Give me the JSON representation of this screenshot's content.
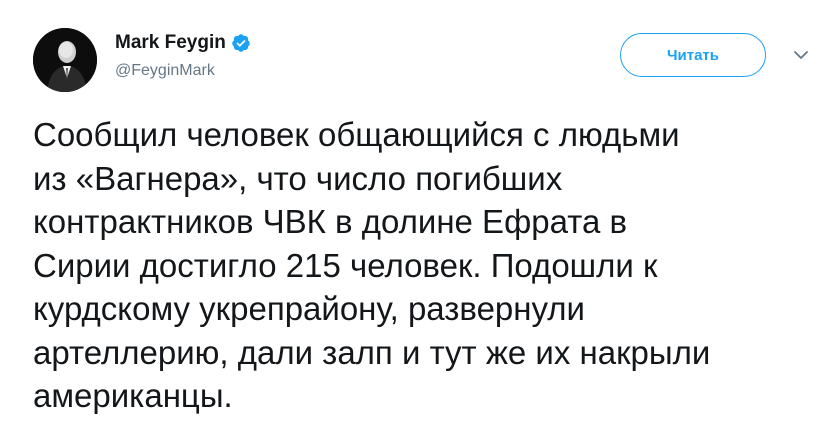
{
  "author": {
    "name": "Mark Feygin",
    "handle": "@FeyginMark",
    "verified": true
  },
  "follow_button": {
    "label": "Читать"
  },
  "icons": {
    "verified": "verified-badge-icon",
    "caret": "chevron-down-icon"
  },
  "tweet": {
    "lines": [
      "Сообщил человек общающийся с людьми",
      "из «Вагнера», что число погибших",
      "контрактников ЧВК в долине Ефрата в",
      "Сирии достигло 215 человек. Подошли к",
      "курдскому укрепрайону, развернули",
      "артеллерию, дали залп и тут же их накрыли",
      "американцы."
    ]
  },
  "colors": {
    "accent": "#1da1f2",
    "text": "#14171a",
    "muted": "#657786"
  }
}
